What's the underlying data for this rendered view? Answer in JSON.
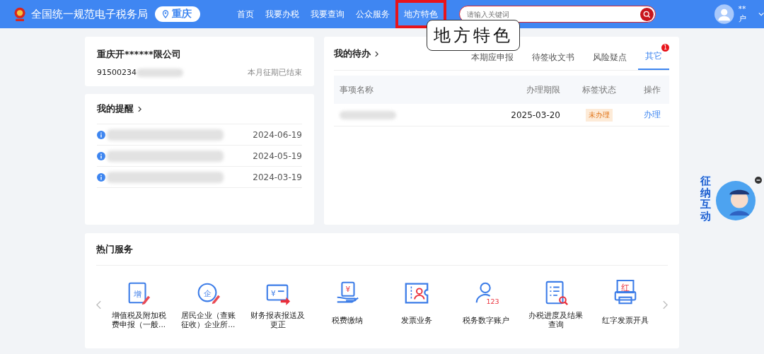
{
  "header": {
    "site_title": "全国统一规范电子税务局",
    "location": "重庆",
    "nav": [
      {
        "label": "首页",
        "selected": false
      },
      {
        "label": "我要办税",
        "selected": false
      },
      {
        "label": "我要查询",
        "selected": false
      },
      {
        "label": "公众服务",
        "selected": false
      },
      {
        "label": "地方特色",
        "selected": true
      }
    ],
    "search": {
      "placeholder": "请输入关键词"
    },
    "user": "**户"
  },
  "callout": "地方特色",
  "company": {
    "name": "重庆开******限公司",
    "tax_id": "91500234",
    "period_status": "本月征期已结束"
  },
  "reminders": {
    "title": "我的提醒",
    "items": [
      {
        "date": "2024-06-19"
      },
      {
        "date": "2024-05-19"
      },
      {
        "date": "2024-03-19"
      }
    ]
  },
  "todo": {
    "title": "我的待办",
    "tabs": [
      {
        "label": "本期应申报",
        "selected": false
      },
      {
        "label": "待签收文书",
        "selected": false
      },
      {
        "label": "风险疑点",
        "selected": false
      },
      {
        "label": "其它",
        "selected": true,
        "badge": "1"
      }
    ],
    "columns": [
      "事项名称",
      "办理期限",
      "标签状态",
      "操作"
    ],
    "rows": [
      {
        "deadline": "2025-03-20",
        "status": "未办理",
        "action": "办理"
      }
    ]
  },
  "hot_services": {
    "title": "热门服务",
    "items": [
      {
        "label": "增值税及附加税费申报（一般...",
        "kind": "doc-pencil",
        "glyph": "增"
      },
      {
        "label": "居民企业（查账征收）企业所...",
        "kind": "circle-pencil",
        "glyph": "企"
      },
      {
        "label": "财务报表报送及更正",
        "kind": "bill-arrow",
        "glyph": "¥"
      },
      {
        "label": "税费缴纳",
        "kind": "hand-doc",
        "glyph": "¥"
      },
      {
        "label": "发票业务",
        "kind": "ticket-person"
      },
      {
        "label": "税务数字账户",
        "kind": "person-number",
        "glyph": "123"
      },
      {
        "label": "办税进度及结果查询",
        "kind": "list-search"
      },
      {
        "label": "红字发票开具",
        "kind": "printer",
        "glyph": "红"
      }
    ]
  },
  "assistant": {
    "label": "征纳互动"
  }
}
